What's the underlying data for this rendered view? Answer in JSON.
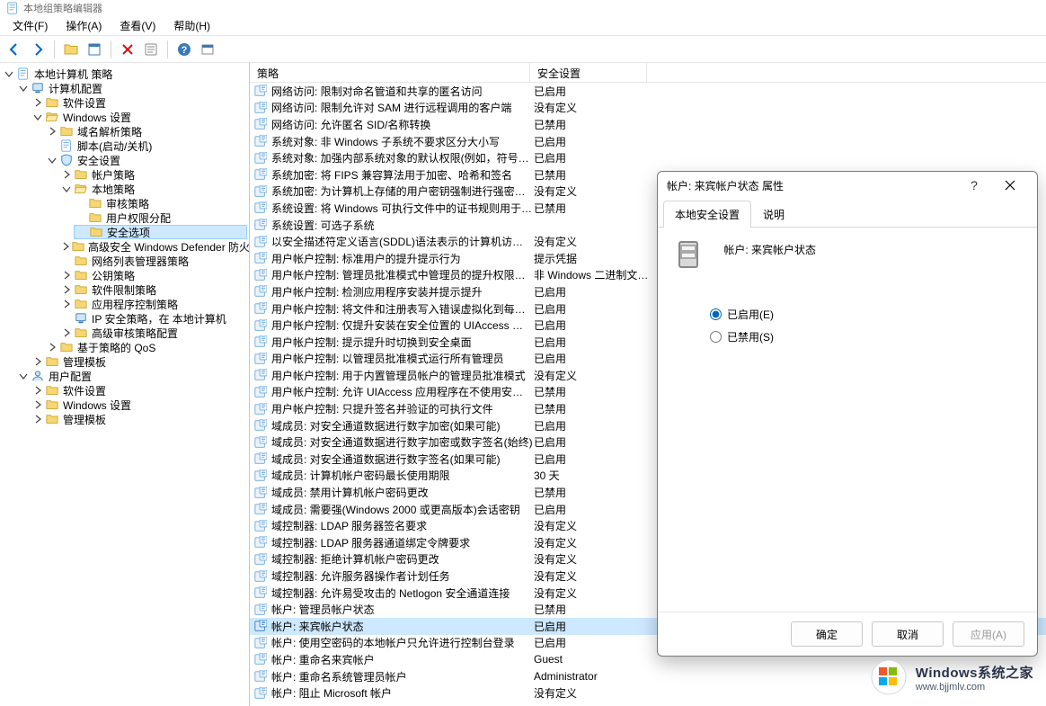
{
  "window": {
    "title": "本地组策略编辑器"
  },
  "menus": {
    "file": "文件(F)",
    "action": "操作(A)",
    "view": "查看(V)",
    "help": "帮助(H)"
  },
  "tree": {
    "root": "本地计算机 策略",
    "computer_cfg": "计算机配置",
    "software_settings": "软件设置",
    "windows_settings": "Windows 设置",
    "dns_policy": "域名解析策略",
    "scripts": "脚本(启动/关机)",
    "security_settings": "安全设置",
    "account_policy": "帐户策略",
    "local_policy": "本地策略",
    "audit_policy": "审核策略",
    "user_rights": "用户权限分配",
    "security_options": "安全选项",
    "defender": "高级安全 Windows Defender 防火墙",
    "nla": "网络列表管理器策略",
    "public_key": "公钥策略",
    "srp": "软件限制策略",
    "acp": "应用程序控制策略",
    "ipsec": "IP 安全策略，在 本地计算机",
    "advaudit": "高级审核策略配置",
    "qos": "基于策略的 QoS",
    "admin_templates": "管理模板",
    "user_cfg": "用户配置",
    "u_software": "软件设置",
    "u_windows": "Windows 设置",
    "u_admin": "管理模板"
  },
  "columns": {
    "policy": "策略",
    "security_setting": "安全设置"
  },
  "rows": [
    {
      "name": "网络访问: 限制对命名管道和共享的匿名访问",
      "val": "已启用"
    },
    {
      "name": "网络访问: 限制允许对 SAM 进行远程调用的客户端",
      "val": "没有定义"
    },
    {
      "name": "网络访问: 允许匿名 SID/名称转换",
      "val": "已禁用"
    },
    {
      "name": "系统对象: 非 Windows 子系统不要求区分大小写",
      "val": "已启用"
    },
    {
      "name": "系统对象: 加强内部系统对象的默认权限(例如，符号链接)",
      "val": "已启用"
    },
    {
      "name": "系统加密: 将 FIPS 兼容算法用于加密、哈希和签名",
      "val": "已禁用"
    },
    {
      "name": "系统加密: 为计算机上存储的用户密钥强制进行强密钥保护",
      "val": "没有定义"
    },
    {
      "name": "系统设置: 将 Windows 可执行文件中的证书规则用于软件限…",
      "val": "已禁用"
    },
    {
      "name": "系统设置: 可选子系统",
      "val": ""
    },
    {
      "name": "以安全描述符定义语言(SDDL)语法表示的计算机访问限制",
      "val": "没有定义"
    },
    {
      "name": "用户帐户控制: 标准用户的提升提示行为",
      "val": "提示凭据"
    },
    {
      "name": "用户帐户控制: 管理员批准模式中管理员的提升权限提示的…",
      "val": "非 Windows 二进制文件…"
    },
    {
      "name": "用户帐户控制: 检测应用程序安装并提示提升",
      "val": "已启用"
    },
    {
      "name": "用户帐户控制: 将文件和注册表写入错误虚拟化到每用户位置",
      "val": "已启用"
    },
    {
      "name": "用户帐户控制: 仅提升安装在安全位置的 UIAccess 应用程序",
      "val": "已启用"
    },
    {
      "name": "用户帐户控制: 提示提升时切换到安全桌面",
      "val": "已启用"
    },
    {
      "name": "用户帐户控制: 以管理员批准模式运行所有管理员",
      "val": "已启用"
    },
    {
      "name": "用户帐户控制: 用于内置管理员帐户的管理员批准模式",
      "val": "没有定义"
    },
    {
      "name": "用户帐户控制: 允许 UIAccess 应用程序在不使用安全桌面的…",
      "val": "已禁用"
    },
    {
      "name": "用户帐户控制: 只提升签名并验证的可执行文件",
      "val": "已禁用"
    },
    {
      "name": "域成员: 对安全通道数据进行数字加密(如果可能)",
      "val": "已启用"
    },
    {
      "name": "域成员: 对安全通道数据进行数字加密或数字签名(始终)",
      "val": "已启用"
    },
    {
      "name": "域成员: 对安全通道数据进行数字签名(如果可能)",
      "val": "已启用"
    },
    {
      "name": "域成员: 计算机帐户密码最长使用期限",
      "val": "30 天"
    },
    {
      "name": "域成员: 禁用计算机帐户密码更改",
      "val": "已禁用"
    },
    {
      "name": "域成员: 需要强(Windows 2000 或更高版本)会话密钥",
      "val": "已启用"
    },
    {
      "name": "域控制器: LDAP 服务器签名要求",
      "val": "没有定义"
    },
    {
      "name": "域控制器: LDAP 服务器通道绑定令牌要求",
      "val": "没有定义"
    },
    {
      "name": "域控制器: 拒绝计算机帐户密码更改",
      "val": "没有定义"
    },
    {
      "name": "域控制器: 允许服务器操作者计划任务",
      "val": "没有定义"
    },
    {
      "name": "域控制器: 允许易受攻击的 Netlogon 安全通道连接",
      "val": "没有定义"
    },
    {
      "name": "帐户: 管理员帐户状态",
      "val": "已禁用"
    },
    {
      "name": "帐户: 来宾帐户状态",
      "val": "已启用"
    },
    {
      "name": "帐户: 使用空密码的本地帐户只允许进行控制台登录",
      "val": "已启用"
    },
    {
      "name": "帐户: 重命名来宾帐户",
      "val": "Guest"
    },
    {
      "name": "帐户: 重命名系统管理员帐户",
      "val": "Administrator"
    },
    {
      "name": "帐户: 阻止 Microsoft 帐户",
      "val": "没有定义"
    }
  ],
  "dialog": {
    "title": "帐户: 来宾帐户状态 属性",
    "tab1": "本地安全设置",
    "tab2": "说明",
    "prop_label": "帐户: 来宾帐户状态",
    "radio_enabled": "已启用(E)",
    "radio_disabled": "已禁用(S)",
    "btn_ok": "确定",
    "btn_cancel": "取消",
    "btn_apply": "应用(A)"
  },
  "watermark": {
    "line1": "Windows系统之家",
    "line2": "www.bjjmlv.com"
  }
}
